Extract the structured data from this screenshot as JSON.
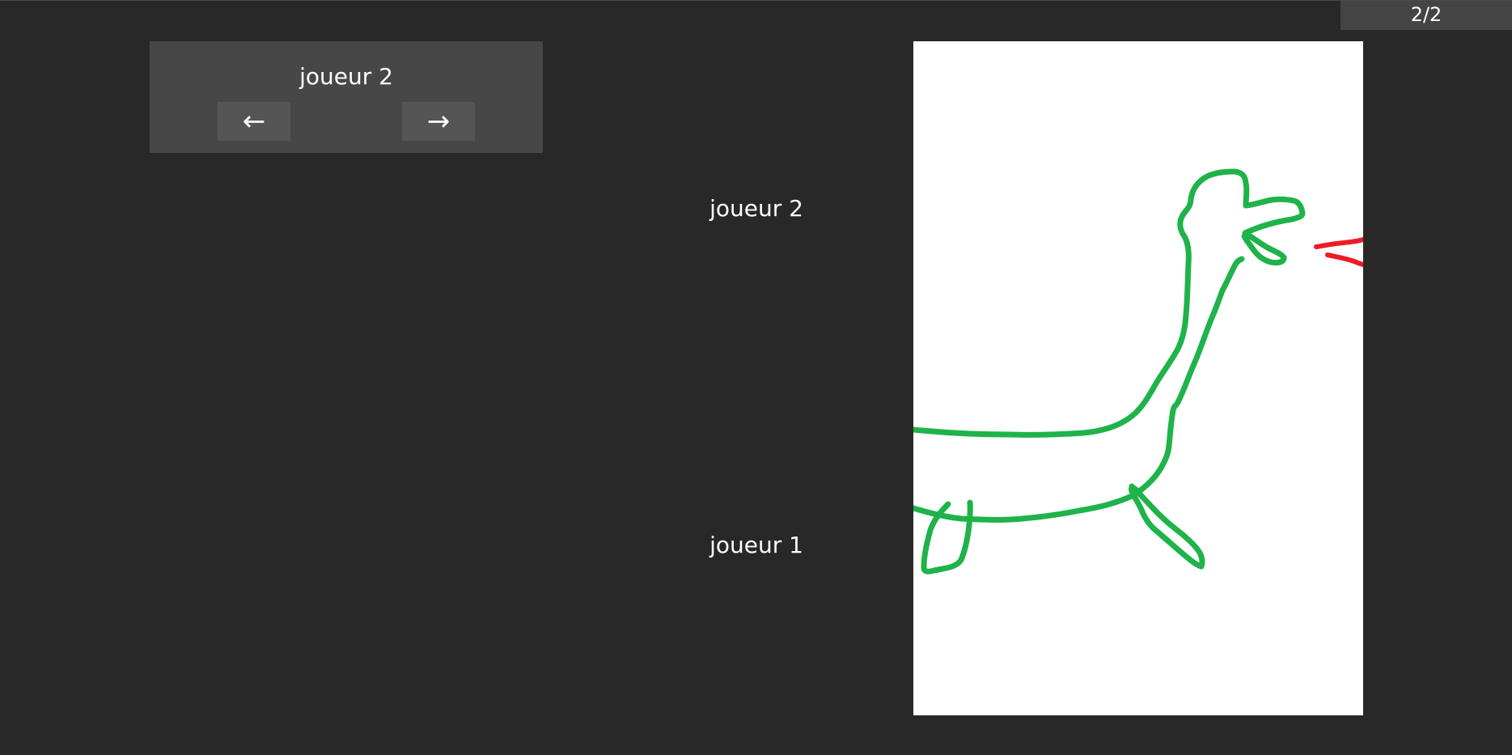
{
  "page_counter": "2/2",
  "navigator": {
    "title": "joueur 2",
    "prev_label": "←",
    "next_label": "→"
  },
  "players": {
    "top_label": "joueur 2",
    "bottom_label": "joueur 1"
  },
  "drawing": {
    "background_color": "#ffffff",
    "stroke_colors": [
      "#1fb34a",
      "#ee1c25"
    ]
  }
}
